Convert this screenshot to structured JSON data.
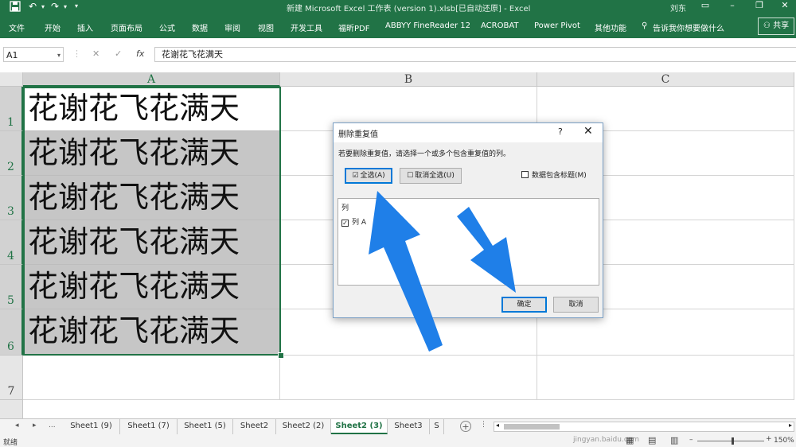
{
  "window": {
    "title": "新建 Microsoft Excel 工作表 (version 1).xlsb[已自动还原]  -  Excel",
    "user": "刘东",
    "qat_icons": [
      "save-icon",
      "undo-icon",
      "redo-icon",
      "customize-icon"
    ]
  },
  "ribbon": {
    "tabs": [
      "文件",
      "开始",
      "插入",
      "页面布局",
      "公式",
      "数据",
      "审阅",
      "视图",
      "开发工具",
      "福昕PDF",
      "ABBYY FineReader 12",
      "ACROBAT",
      "Power Pivot",
      "其他功能"
    ],
    "tell_me": "告诉我你想要做什么",
    "share": "共享"
  },
  "formula_bar": {
    "name_box": "A1",
    "fx": "fx",
    "content": "花谢花飞花满天"
  },
  "sheet": {
    "columns": [
      "A",
      "B",
      "C"
    ],
    "rows": [
      "1",
      "2",
      "3",
      "4",
      "5",
      "6",
      "7"
    ],
    "cells_A": [
      "花谢花飞花满天",
      "花谢花飞花满天",
      "花谢花飞花满天",
      "花谢花飞花满天",
      "花谢花飞花满天",
      "花谢花飞花满天"
    ]
  },
  "dialog": {
    "title": "删除重复值",
    "help": "?",
    "close": "✕",
    "description": "若要删除重复值，请选择一个或多个包含重复值的列。",
    "select_all": "全选(A)",
    "unselect_all": "取消全选(U)",
    "has_headers": "数据包含标题(M)",
    "has_headers_checked": false,
    "columns_header": "列",
    "column_items": [
      {
        "label": "列 A",
        "checked": true
      }
    ],
    "ok": "确定",
    "cancel": "取消"
  },
  "sheet_tabs": {
    "ellipsis": "...",
    "tabs": [
      "Sheet1 (9)",
      "Sheet1 (7)",
      "Sheet1 (5)",
      "Sheet2",
      "Sheet2 (2)",
      "Sheet2 (3)",
      "Sheet3",
      "S"
    ],
    "active": "Sheet2 (3)"
  },
  "status": {
    "mode": "就绪",
    "zoom": "150%",
    "watermark_text": "jingyan.baidu.com"
  },
  "colors": {
    "excel_green": "#217346",
    "arrow_blue": "#1f7fe8"
  }
}
